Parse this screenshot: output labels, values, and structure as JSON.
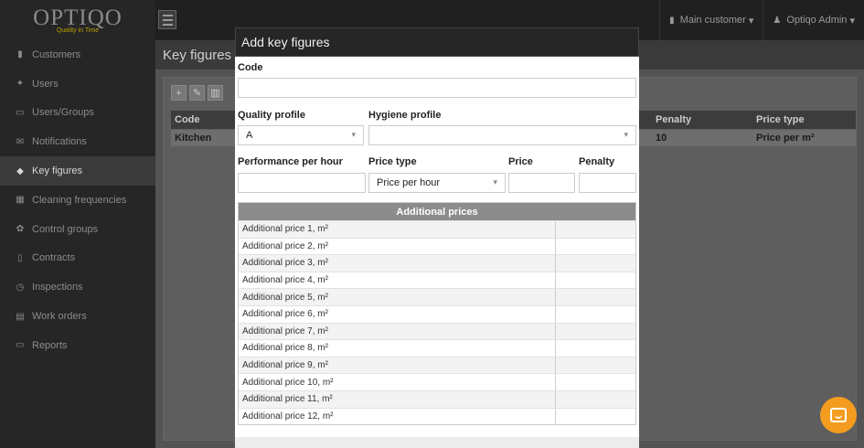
{
  "brand": {
    "logo": "OPTIQO",
    "tagline": "Quality in Time"
  },
  "sidebar": {
    "items": [
      {
        "label": "Customers",
        "icon": "briefcase-icon",
        "glyph": "▮"
      },
      {
        "label": "Users",
        "icon": "users-icon",
        "glyph": "✦"
      },
      {
        "label": "Users/Groups",
        "icon": "id-card-icon",
        "glyph": "▭"
      },
      {
        "label": "Notifications",
        "icon": "envelope-icon",
        "glyph": "✉"
      },
      {
        "label": "Key figures",
        "icon": "tag-icon",
        "glyph": "◆",
        "active": true
      },
      {
        "label": "Cleaning frequencies",
        "icon": "calendar-icon",
        "glyph": "▦"
      },
      {
        "label": "Control groups",
        "icon": "cubes-icon",
        "glyph": "✿"
      },
      {
        "label": "Contracts",
        "icon": "document-icon",
        "glyph": "▯"
      },
      {
        "label": "Inspections",
        "icon": "clock-icon",
        "glyph": "◷"
      },
      {
        "label": "Work orders",
        "icon": "list-icon",
        "glyph": "▤"
      },
      {
        "label": "Reports",
        "icon": "monitor-icon",
        "glyph": "▭"
      }
    ]
  },
  "topbar": {
    "customer_menu": "Main customer",
    "user_menu": "Optiqo Admin"
  },
  "page": {
    "title": "Key figures",
    "grid": {
      "columns": [
        "Code",
        "Penalty",
        "Price type"
      ],
      "rows": [
        {
          "code": "Kitchen",
          "penalty": "10",
          "price_type": "Price per m²"
        }
      ]
    }
  },
  "modal": {
    "title": "Add key figures",
    "code_label": "Code",
    "code_value": "",
    "quality_profile_label": "Quality profile",
    "quality_profile_value": "A",
    "hygiene_profile_label": "Hygiene profile",
    "hygiene_profile_value": "",
    "performance_label": "Performance per hour",
    "performance_value": "",
    "price_type_label": "Price type",
    "price_type_value": "Price per hour",
    "price_label": "Price",
    "price_value": "",
    "penalty_label": "Penalty",
    "penalty_value": "",
    "additional_prices_title": "Additional prices",
    "additional_prices": [
      "Additional price 1, m²",
      "Additional price 2, m²",
      "Additional price 3, m²",
      "Additional price 4, m²",
      "Additional price 5, m²",
      "Additional price 6, m²",
      "Additional price 7, m²",
      "Additional price 8, m²",
      "Additional price 9, m²",
      "Additional price 10, m²",
      "Additional price 11, m²",
      "Additional price 12, m²"
    ]
  },
  "colors": {
    "accent_chat": "#f39c1f",
    "sidebar_bg": "#262626",
    "modal_header": "#262626"
  }
}
